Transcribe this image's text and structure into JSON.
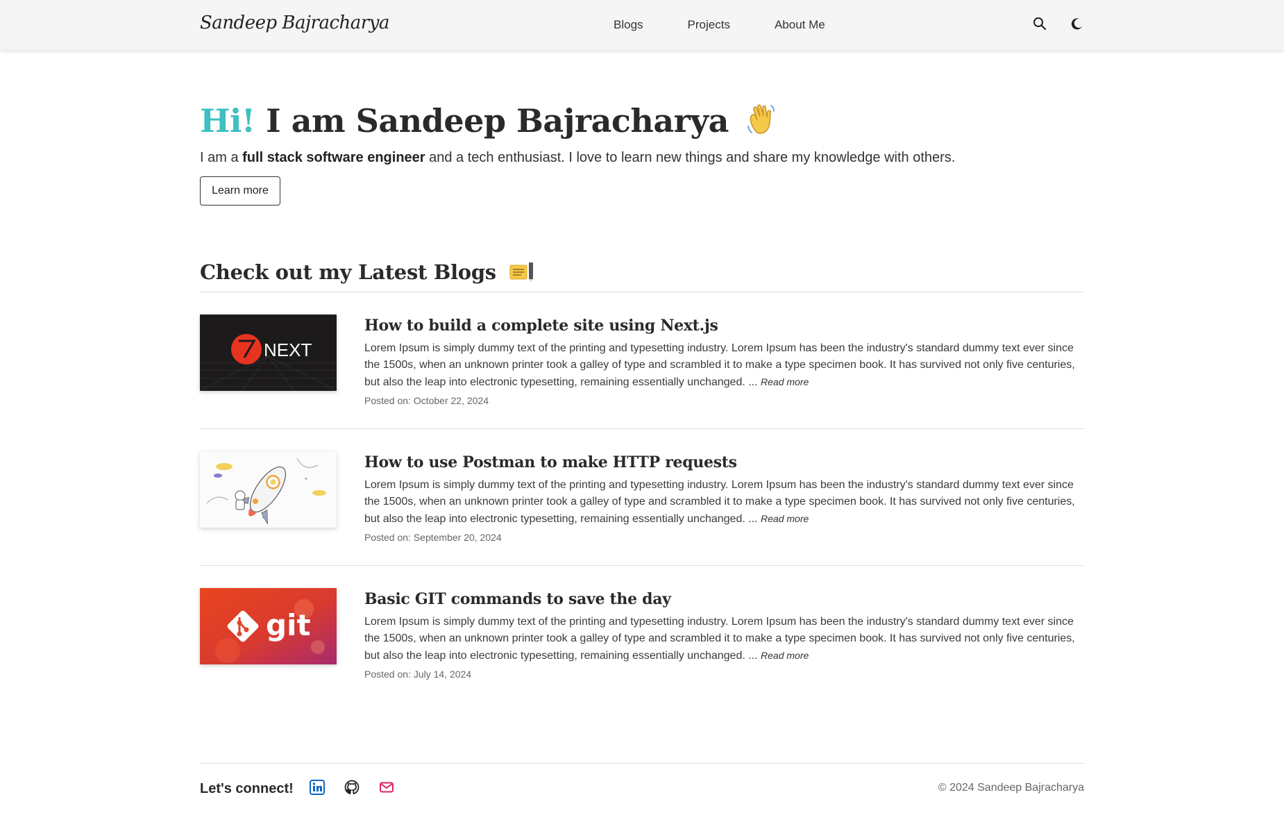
{
  "nav": {
    "logo": "Sandeep Bajracharya",
    "links": [
      "Blogs",
      "Projects",
      "About Me"
    ],
    "icons": [
      "search-icon",
      "moon-icon"
    ]
  },
  "hero": {
    "greeting": "Hi!",
    "name_text": "I am Sandeep Bajracharya",
    "emoji": "waving-hand",
    "subtitle_pre": "I am a ",
    "subtitle_bold": "full stack software engineer",
    "subtitle_post": " and a tech enthusiast. I love to learn new things and share my knowledge with others.",
    "button": "Learn more"
  },
  "blogs": {
    "heading": "Check out my Latest Blogs",
    "emoji": "memo",
    "read_more": "Read more",
    "posts": [
      {
        "title": "How to build a complete site using Next.js",
        "excerpt": "Lorem Ipsum is simply dummy text of the printing and typesetting industry. Lorem Ipsum has been the industry's standard dummy text ever since the 1500s, when an unknown printer took a galley of type and scrambled it to make a type specimen book. It has survived not only five centuries, but also the leap into electronic typesetting, remaining essentially unchanged. ...",
        "date": "Posted on: October 22, 2024",
        "thumb_text": "NEXT"
      },
      {
        "title": "How to use Postman to make HTTP requests",
        "excerpt": "Lorem Ipsum is simply dummy text of the printing and typesetting industry. Lorem Ipsum has been the industry's standard dummy text ever since the 1500s, when an unknown printer took a galley of type and scrambled it to make a type specimen book. It has survived not only five centuries, but also the leap into electronic typesetting, remaining essentially unchanged. ...",
        "date": "Posted on: September 20, 2024",
        "thumb_text": ""
      },
      {
        "title": "Basic GIT commands to save the day",
        "excerpt": "Lorem Ipsum is simply dummy text of the printing and typesetting industry. Lorem Ipsum has been the industry's standard dummy text ever since the 1500s, when an unknown printer took a galley of type and scrambled it to make a type specimen book. It has survived not only five centuries, but also the leap into electronic typesetting, remaining essentially unchanged. ...",
        "date": "Posted on: July 14, 2024",
        "thumb_text": "git"
      }
    ]
  },
  "footer": {
    "connect": "Let's connect!",
    "social_icons": [
      "linkedin-icon",
      "github-icon",
      "email-icon"
    ],
    "copyright": "© 2024 Sandeep Bajracharya"
  },
  "colors": {
    "accent": "#3fbfbf",
    "linkedin": "#0a66c2",
    "email": "#e0245e"
  }
}
